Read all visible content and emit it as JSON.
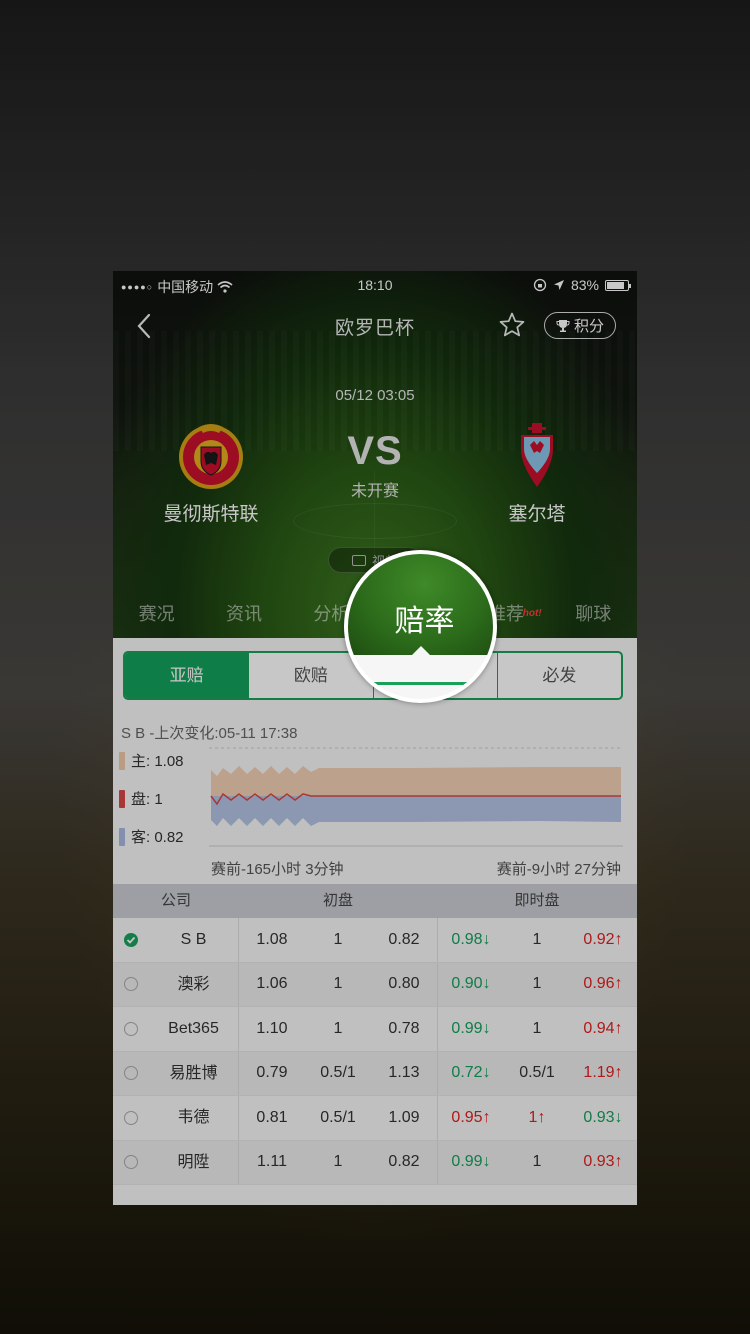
{
  "status_bar": {
    "signal": "●●●●○",
    "carrier": "中国移动",
    "time": "18:10",
    "battery": "83%"
  },
  "nav": {
    "title": "欧罗巴杯",
    "points_label": "积分"
  },
  "match": {
    "datetime": "05/12 03:05",
    "vs": "VS",
    "status": "未开赛",
    "home_team": "曼彻斯特联",
    "away_team": "塞尔塔",
    "video_label": "视频"
  },
  "tabs": [
    {
      "label": "赛况"
    },
    {
      "label": "资讯"
    },
    {
      "label": "分析"
    },
    {
      "label": "赔率"
    },
    {
      "label": "推荐",
      "badge": "hot!"
    },
    {
      "label": "聊球"
    }
  ],
  "active_tab": "赔率",
  "subtabs": [
    {
      "label": "亚赔",
      "active": true
    },
    {
      "label": "欧赔",
      "active": false
    },
    {
      "label": "",
      "active": false
    },
    {
      "label": "必发",
      "active": false
    }
  ],
  "chart": {
    "caption": "S B -上次变化:05-11 17:38",
    "legend": [
      {
        "label": "主: 1.08",
        "color": "#f0c8a8"
      },
      {
        "label": "盘: 1",
        "color": "#d84848"
      },
      {
        "label": "客: 0.82",
        "color": "#a8b8e0"
      }
    ],
    "from_label": "赛前-165小时 3分钟",
    "to_label": "赛前-9小时 27分钟"
  },
  "table": {
    "headers": [
      "公司",
      "初盘",
      "即时盘"
    ],
    "rows": [
      {
        "company": "S B",
        "selected": true,
        "init": [
          "1.08",
          "1",
          "0.82"
        ],
        "live": [
          "0.98↓",
          "1",
          "0.92↑"
        ],
        "live_color": [
          "green",
          "",
          "red"
        ]
      },
      {
        "company": "澳彩",
        "selected": false,
        "init": [
          "1.06",
          "1",
          "0.80"
        ],
        "live": [
          "0.90↓",
          "1",
          "0.96↑"
        ],
        "live_color": [
          "green",
          "",
          "red"
        ]
      },
      {
        "company": "Bet365",
        "selected": false,
        "init": [
          "1.10",
          "1",
          "0.78"
        ],
        "live": [
          "0.99↓",
          "1",
          "0.94↑"
        ],
        "live_color": [
          "green",
          "",
          "red"
        ]
      },
      {
        "company": "易胜博",
        "selected": false,
        "init": [
          "0.79",
          "0.5/1",
          "1.13"
        ],
        "live": [
          "0.72↓",
          "0.5/1",
          "1.19↑"
        ],
        "live_color": [
          "green",
          "",
          "red"
        ]
      },
      {
        "company": "韦德",
        "selected": false,
        "init": [
          "0.81",
          "0.5/1",
          "1.09"
        ],
        "live": [
          "0.95↑",
          "1↑",
          "0.93↓"
        ],
        "live_color": [
          "red",
          "red",
          "green"
        ]
      },
      {
        "company": "明陞",
        "selected": false,
        "init": [
          "1.11",
          "1",
          "0.82"
        ],
        "live": [
          "0.99↓",
          "1",
          "0.93↑"
        ],
        "live_color": [
          "green",
          "",
          "red"
        ]
      }
    ]
  },
  "magnifier": {
    "label": "赔率"
  },
  "colors": {
    "accent_green": "#14a05c",
    "up_red": "#e02020",
    "down_green": "#14a05c"
  }
}
